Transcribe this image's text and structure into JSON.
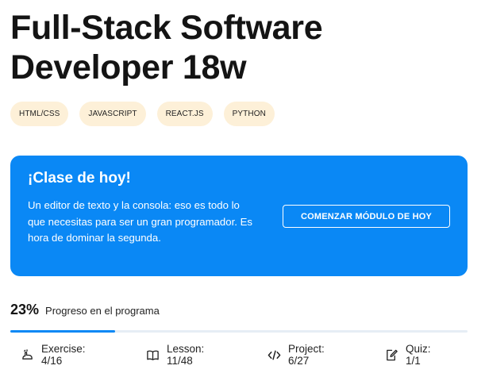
{
  "course": {
    "title_line1": "Full-Stack Software",
    "title_line2": "Developer 18w"
  },
  "tags": [
    "HTML/CSS",
    "JAVASCRIPT",
    "REACT.JS",
    "PYTHON"
  ],
  "today_card": {
    "heading": "¡Clase de hoy!",
    "description": "Un editor de texto y la consola: eso es todo lo que necesitas para ser un gran programador. Es hora de dominar la segunda.",
    "button_label": "COMENZAR MÓDULO DE HOY",
    "background_color": "#0a88f5"
  },
  "progress": {
    "percent_text": "23%",
    "label": "Progreso en el programa",
    "fraction": 0.23,
    "bar_color": "#0a88f5"
  },
  "stats": {
    "exercise": {
      "label": "Exercise: 4/16",
      "icon": "exercise-icon"
    },
    "lesson": {
      "label": "Lesson: 11/48",
      "icon": "book-icon"
    },
    "project": {
      "label": "Project: 6/27",
      "icon": "code-icon"
    },
    "quiz": {
      "label": "Quiz: 1/1",
      "icon": "quiz-edit-icon"
    }
  }
}
